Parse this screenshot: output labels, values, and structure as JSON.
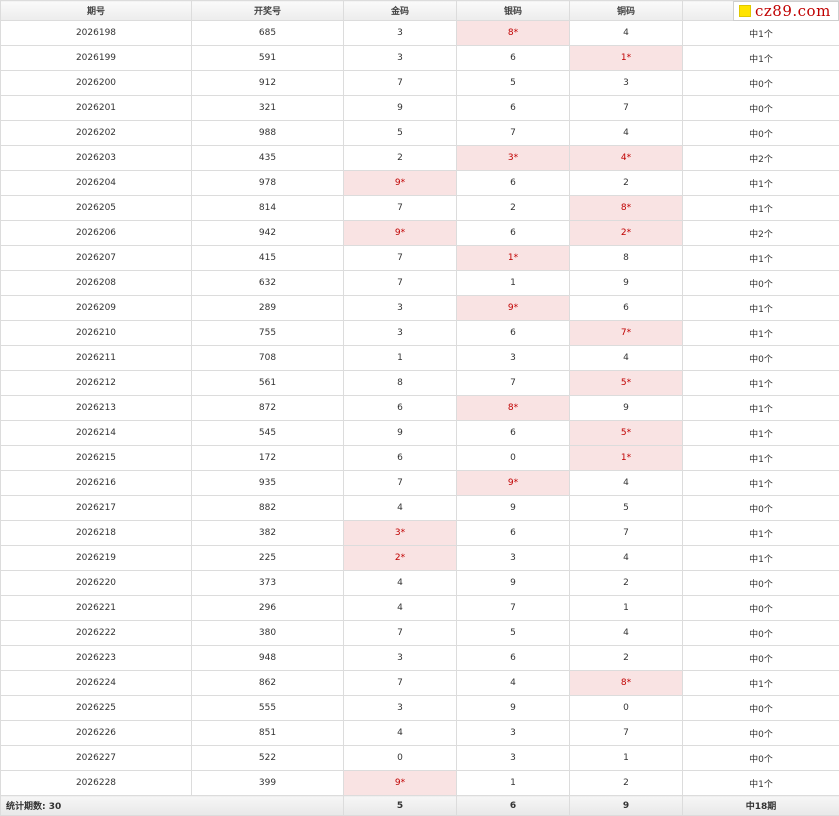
{
  "table": {
    "headers": [
      "期号",
      "开奖号",
      "金码",
      "银码",
      "铜码",
      ""
    ],
    "rows": [
      {
        "period": "2026198",
        "number": "685",
        "gold": "3",
        "silver": "8*",
        "bronze": "4",
        "result": "中1个"
      },
      {
        "period": "2026199",
        "number": "591",
        "gold": "3",
        "silver": "6",
        "bronze": "1*",
        "result": "中1个"
      },
      {
        "period": "2026200",
        "number": "912",
        "gold": "7",
        "silver": "5",
        "bronze": "3",
        "result": "中0个"
      },
      {
        "period": "2026201",
        "number": "321",
        "gold": "9",
        "silver": "6",
        "bronze": "7",
        "result": "中0个"
      },
      {
        "period": "2026202",
        "number": "988",
        "gold": "5",
        "silver": "7",
        "bronze": "4",
        "result": "中0个"
      },
      {
        "period": "2026203",
        "number": "435",
        "gold": "2",
        "silver": "3*",
        "bronze": "4*",
        "result": "中2个"
      },
      {
        "period": "2026204",
        "number": "978",
        "gold": "9*",
        "silver": "6",
        "bronze": "2",
        "result": "中1个"
      },
      {
        "period": "2026205",
        "number": "814",
        "gold": "7",
        "silver": "2",
        "bronze": "8*",
        "result": "中1个"
      },
      {
        "period": "2026206",
        "number": "942",
        "gold": "9*",
        "silver": "6",
        "bronze": "2*",
        "result": "中2个"
      },
      {
        "period": "2026207",
        "number": "415",
        "gold": "7",
        "silver": "1*",
        "bronze": "8",
        "result": "中1个"
      },
      {
        "period": "2026208",
        "number": "632",
        "gold": "7",
        "silver": "1",
        "bronze": "9",
        "result": "中0个"
      },
      {
        "period": "2026209",
        "number": "289",
        "gold": "3",
        "silver": "9*",
        "bronze": "6",
        "result": "中1个"
      },
      {
        "period": "2026210",
        "number": "755",
        "gold": "3",
        "silver": "6",
        "bronze": "7*",
        "result": "中1个"
      },
      {
        "period": "2026211",
        "number": "708",
        "gold": "1",
        "silver": "3",
        "bronze": "4",
        "result": "中0个"
      },
      {
        "period": "2026212",
        "number": "561",
        "gold": "8",
        "silver": "7",
        "bronze": "5*",
        "result": "中1个"
      },
      {
        "period": "2026213",
        "number": "872",
        "gold": "6",
        "silver": "8*",
        "bronze": "9",
        "result": "中1个"
      },
      {
        "period": "2026214",
        "number": "545",
        "gold": "9",
        "silver": "6",
        "bronze": "5*",
        "result": "中1个"
      },
      {
        "period": "2026215",
        "number": "172",
        "gold": "6",
        "silver": "0",
        "bronze": "1*",
        "result": "中1个"
      },
      {
        "period": "2026216",
        "number": "935",
        "gold": "7",
        "silver": "9*",
        "bronze": "4",
        "result": "中1个"
      },
      {
        "period": "2026217",
        "number": "882",
        "gold": "4",
        "silver": "9",
        "bronze": "5",
        "result": "中0个"
      },
      {
        "period": "2026218",
        "number": "382",
        "gold": "3*",
        "silver": "6",
        "bronze": "7",
        "result": "中1个"
      },
      {
        "period": "2026219",
        "number": "225",
        "gold": "2*",
        "silver": "3",
        "bronze": "4",
        "result": "中1个"
      },
      {
        "period": "2026220",
        "number": "373",
        "gold": "4",
        "silver": "9",
        "bronze": "2",
        "result": "中0个"
      },
      {
        "period": "2026221",
        "number": "296",
        "gold": "4",
        "silver": "7",
        "bronze": "1",
        "result": "中0个"
      },
      {
        "period": "2026222",
        "number": "380",
        "gold": "7",
        "silver": "5",
        "bronze": "4",
        "result": "中0个"
      },
      {
        "period": "2026223",
        "number": "948",
        "gold": "3",
        "silver": "6",
        "bronze": "2",
        "result": "中0个"
      },
      {
        "period": "2026224",
        "number": "862",
        "gold": "7",
        "silver": "4",
        "bronze": "8*",
        "result": "中1个"
      },
      {
        "period": "2026225",
        "number": "555",
        "gold": "3",
        "silver": "9",
        "bronze": "0",
        "result": "中0个"
      },
      {
        "period": "2026226",
        "number": "851",
        "gold": "4",
        "silver": "3",
        "bronze": "7",
        "result": "中0个"
      },
      {
        "period": "2026227",
        "number": "522",
        "gold": "0",
        "silver": "3",
        "bronze": "1",
        "result": "中0个"
      },
      {
        "period": "2026228",
        "number": "399",
        "gold": "9*",
        "silver": "1",
        "bronze": "2",
        "result": "中1个"
      }
    ],
    "summary": {
      "label": "统计期数: 30",
      "gold_hits": "5",
      "silver_hits": "6",
      "bronze_hits": "9",
      "total_hits": "中18期"
    }
  },
  "logo": {
    "text": "cz89.com",
    "square_color": "#ffe400",
    "text_color": "#c00000"
  },
  "colors": {
    "hit_background": "#f9e3e3",
    "hit_text": "#c00000",
    "header_background": "#ececec",
    "border": "#dcdcdc"
  }
}
